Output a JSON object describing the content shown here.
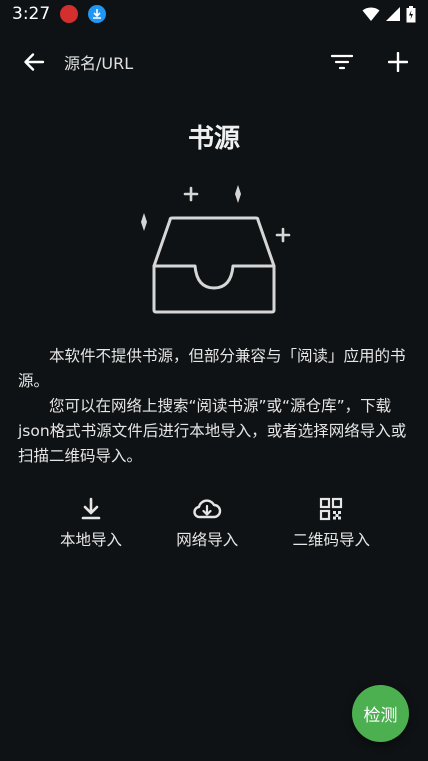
{
  "status_bar": {
    "time": "3:27",
    "icons": [
      "app-notification-icon",
      "download-icon",
      "wifi-icon",
      "signal-icon",
      "battery-icon"
    ]
  },
  "toolbar": {
    "search_hint": "源名/URL",
    "icons": [
      "back-arrow-icon",
      "filter-icon",
      "add-icon"
    ]
  },
  "empty_state": {
    "title": "书源",
    "paragraph1": "本软件不提供书源，但部分兼容与「阅读」应用的书源。",
    "paragraph2": "您可以在网络上搜索“阅读书源”或“源仓库”，下载json格式书源文件后进行本地导入，或者选择网络导入或扫描二维码导入。"
  },
  "actions": [
    {
      "label": "本地导入",
      "icon": "download-icon"
    },
    {
      "label": "网络导入",
      "icon": "cloud-download-icon"
    },
    {
      "label": "二维码导入",
      "icon": "qr-code-icon"
    }
  ],
  "fab": {
    "label": "检测"
  },
  "colors": {
    "background": "#0f1214",
    "fab": "#4caf50",
    "accent_blue": "#2196f3"
  }
}
